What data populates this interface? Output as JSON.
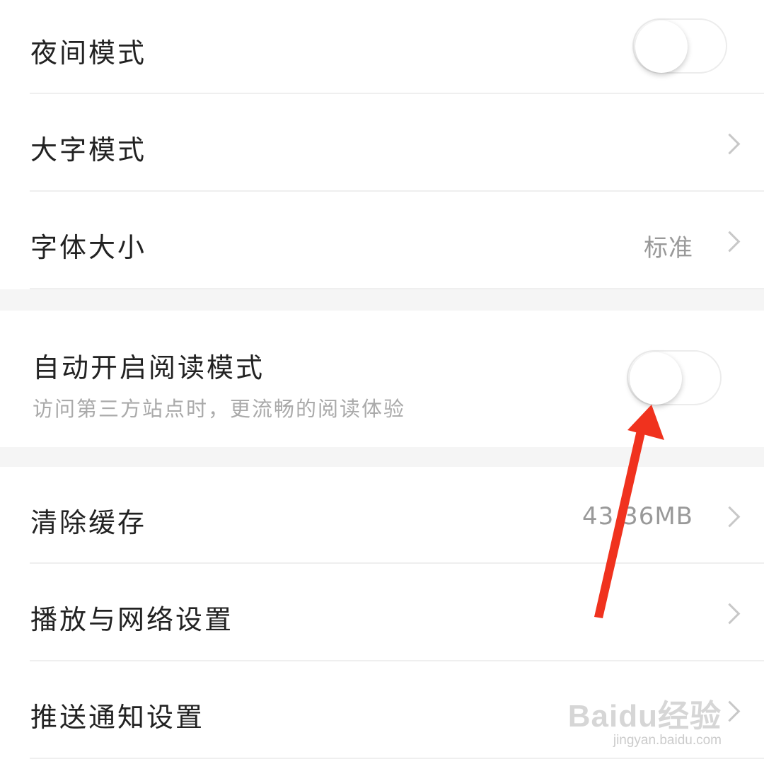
{
  "settings": {
    "night_mode": {
      "label": "夜间模式",
      "enabled": false
    },
    "large_text": {
      "label": "大字模式"
    },
    "font_size": {
      "label": "字体大小",
      "value": "标准"
    },
    "auto_reader": {
      "label": "自动开启阅读模式",
      "subtitle": "访问第三方站点时，更流畅的阅读体验",
      "enabled": false
    },
    "clear_cache": {
      "label": "清除缓存",
      "value": "43.36MB"
    },
    "playback_network": {
      "label": "播放与网络设置"
    },
    "push_notifications": {
      "label": "推送通知设置"
    }
  },
  "watermark": {
    "brand": "Baidu经验",
    "url": "jingyan.baidu.com"
  },
  "colors": {
    "arrow": "#f0321e",
    "toggle_off": "#ffffff",
    "gap_background": "#f5f5f5"
  }
}
